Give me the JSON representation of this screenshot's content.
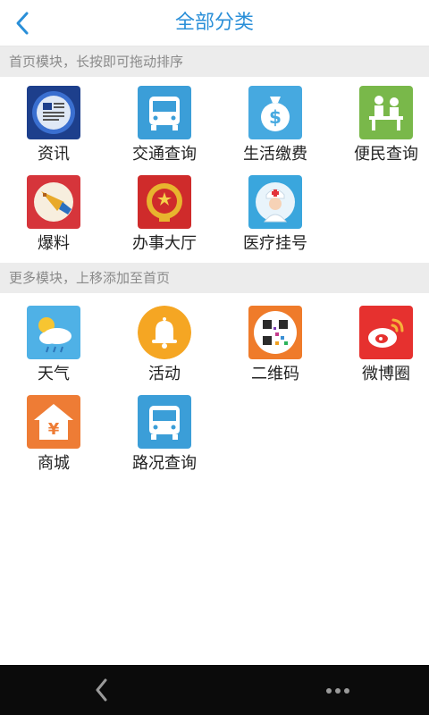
{
  "header": {
    "title": "全部分类",
    "back_icon": "chevron-left-icon"
  },
  "section_home": {
    "hint": "首页模块，长按即可拖动排序",
    "items": [
      {
        "label": "资讯",
        "icon": "news-icon"
      },
      {
        "label": "交通查询",
        "icon": "bus-icon"
      },
      {
        "label": "生活缴费",
        "icon": "money-bag-icon"
      },
      {
        "label": "便民查询",
        "icon": "service-counter-icon"
      },
      {
        "label": "爆料",
        "icon": "megaphone-icon"
      },
      {
        "label": "办事大厅",
        "icon": "national-emblem-icon"
      },
      {
        "label": "医疗挂号",
        "icon": "nurse-icon"
      }
    ]
  },
  "section_more": {
    "hint": "更多模块，上移添加至首页",
    "items": [
      {
        "label": "天气",
        "icon": "weather-icon"
      },
      {
        "label": "活动",
        "icon": "bell-icon"
      },
      {
        "label": "二维码",
        "icon": "qr-code-icon"
      },
      {
        "label": "微博圈",
        "icon": "weibo-icon"
      },
      {
        "label": "商城",
        "icon": "shop-icon"
      },
      {
        "label": "路况查询",
        "icon": "bus-icon"
      }
    ]
  },
  "bottom_bar": {
    "back_icon": "chevron-left-icon",
    "more_icon": "more-dots-icon"
  },
  "colors": {
    "accent": "#2a8fd8",
    "section_bg": "#ececec",
    "bottom_bar": "#0b0b0b"
  }
}
